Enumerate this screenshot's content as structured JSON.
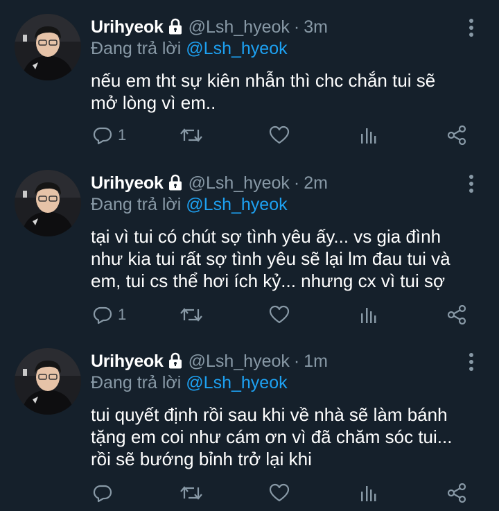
{
  "tweets": [
    {
      "name": "Urihyeok",
      "handle": "@Lsh_hyeok",
      "separator": "·",
      "time": "3m",
      "reply_prefix": "Đang trả lời",
      "reply_to": "@Lsh_hyeok",
      "text": "nếu em tht sự kiên nhẫn thì chc chắn tui sẽ\nmở lòng vì em..",
      "reply_count": "1"
    },
    {
      "name": "Urihyeok",
      "handle": "@Lsh_hyeok",
      "separator": "·",
      "time": "2m",
      "reply_prefix": "Đang trả lời",
      "reply_to": "@Lsh_hyeok",
      "text": "tại vì tui có chút sợ tình yêu ấy... vs gia đình\nnhư kia tui rất sợ tình yêu sẽ lại lm đau tui và\nem, tui cs thể hơi ích kỷ... nhưng cx vì tui sợ",
      "reply_count": "1"
    },
    {
      "name": "Urihyeok",
      "handle": "@Lsh_hyeok",
      "separator": "·",
      "time": "1m",
      "reply_prefix": "Đang trả lời",
      "reply_to": "@Lsh_hyeok",
      "text": "tui quyết định rồi sau khi về nhà sẽ làm bánh\ntặng em coi như cám ơn vì đã chăm sóc tui...\nrồi sẽ bướng bỉnh trở lại khi",
      "reply_count": ""
    }
  ],
  "icons": {
    "lock": "lock-icon",
    "more": "more-vertical-icon",
    "reply": "reply-icon",
    "retweet": "retweet-icon",
    "like": "heart-icon",
    "analytics": "analytics-icon",
    "share": "share-icon"
  },
  "colors": {
    "background": "#15202b",
    "text": "#ffffff",
    "secondary": "#8899a6",
    "mention": "#1da1f2"
  }
}
